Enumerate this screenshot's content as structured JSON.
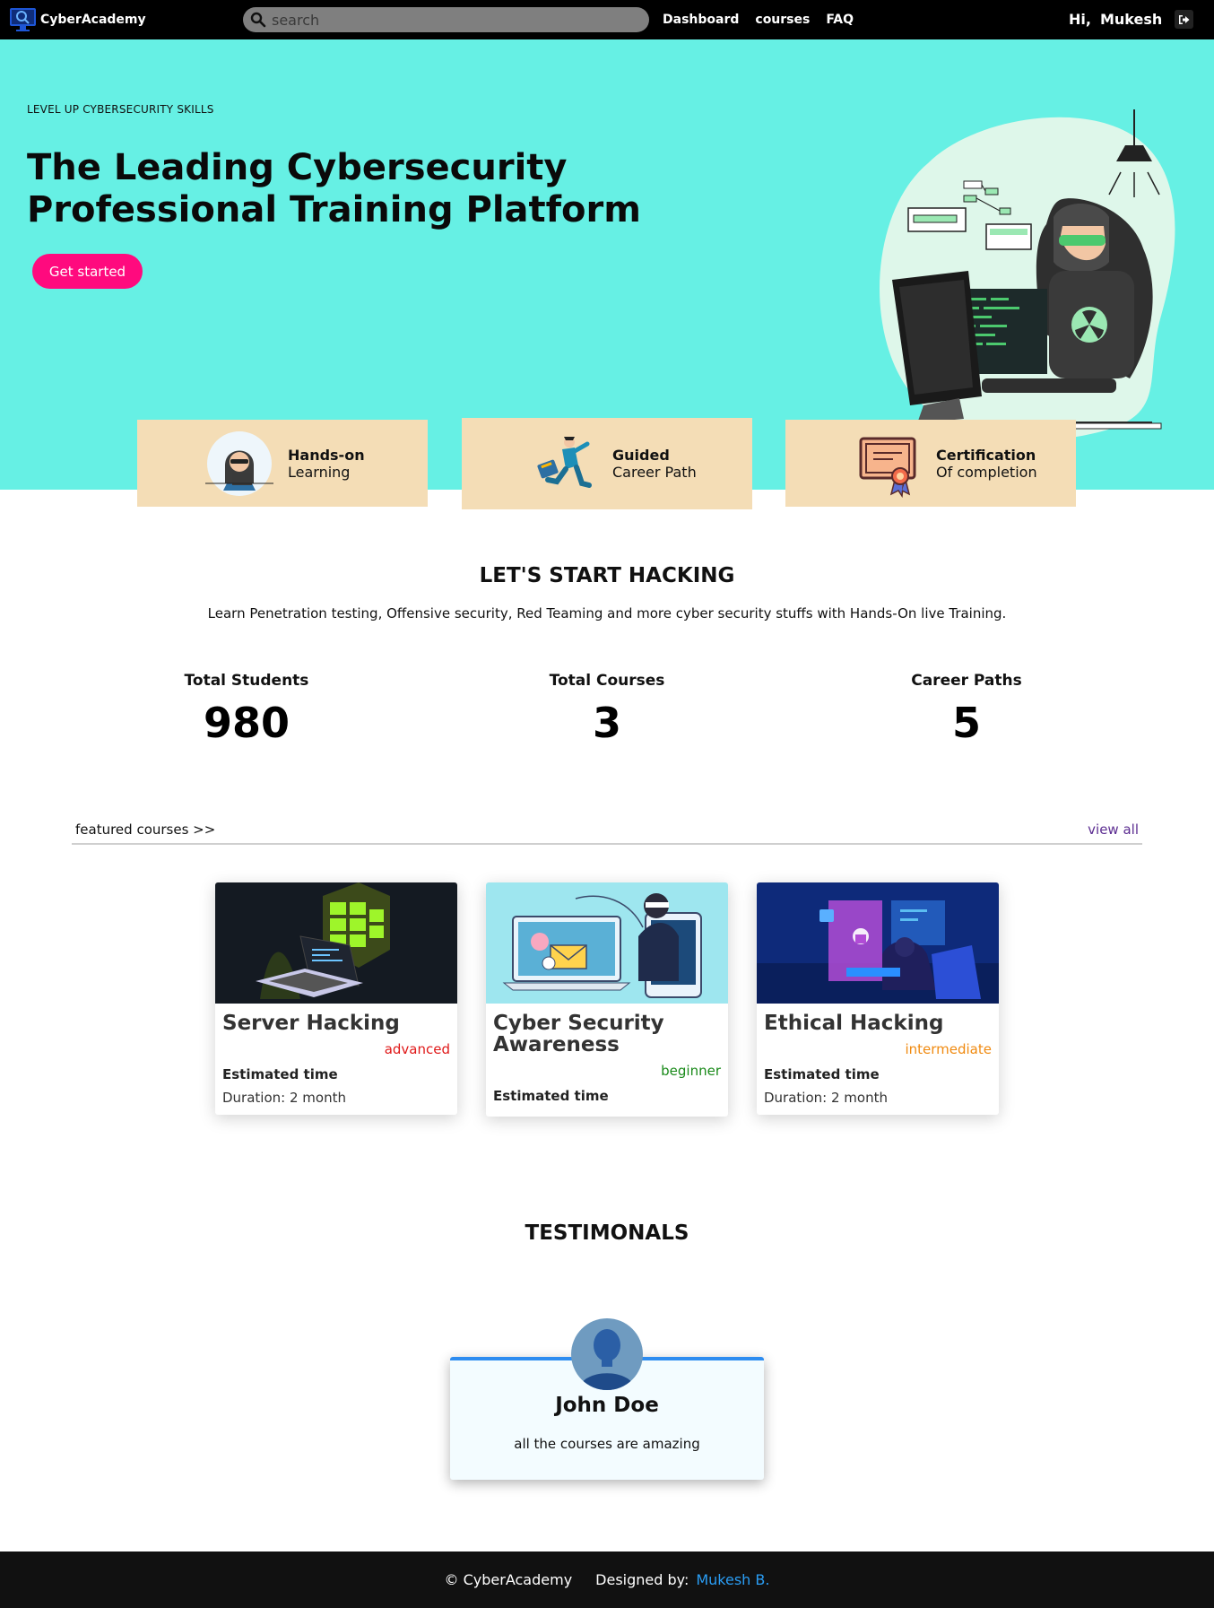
{
  "nav": {
    "brand": "CyberAcademy",
    "search_placeholder": "search",
    "links": [
      "Dashboard",
      "courses",
      "FAQ"
    ],
    "greeting": "Hi,",
    "user": "Mukesh",
    "logout_icon": "logout-icon"
  },
  "hero": {
    "kicker": "LEVEL UP CYBERSECURITY SKILLS",
    "title": "The Leading Cybersecurity Professional Training Platform",
    "cta": "Get started",
    "cta_color": "#ff0a7e",
    "background": "#66f0e4"
  },
  "features": [
    {
      "title": "Hands-on",
      "subtitle": "Learning",
      "icon": "hacker-avatar-icon"
    },
    {
      "title": "Guided",
      "subtitle": "Career Path",
      "icon": "running-man-icon"
    },
    {
      "title": "Certification",
      "subtitle": "Of completion",
      "icon": "certificate-icon"
    }
  ],
  "intro": {
    "title": "LET'S START HACKING",
    "subtitle": "Learn Penetration testing, Offensive security, Red Teaming and more cyber security stuffs with Hands-On live Training."
  },
  "stats": [
    {
      "label": "Total Students",
      "value": "980"
    },
    {
      "label": "Total Courses",
      "value": "3"
    },
    {
      "label": "Career Paths",
      "value": "5"
    }
  ],
  "featured": {
    "heading": "featured courses >>",
    "view_all": "view all",
    "courses": [
      {
        "title": "Server Hacking",
        "level": "advanced",
        "level_color": "#e01919",
        "est_label": "Estimated time",
        "duration": "Duration: 2 month"
      },
      {
        "title": "Cyber Security Awareness",
        "level": "beginner",
        "level_color": "#1a8a1a",
        "est_label": "Estimated time",
        "duration": ""
      },
      {
        "title": "Ethical Hacking",
        "level": "intermediate",
        "level_color": "#f08a10",
        "est_label": "Estimated time",
        "duration": "Duration: 2 month"
      }
    ]
  },
  "testimonials": {
    "title": "TESTIMONALS",
    "items": [
      {
        "name": "John Doe",
        "quote": "all the courses are amazing"
      }
    ]
  },
  "footer": {
    "copyright": "© CyberAcademy",
    "designed_label": "Designed by:",
    "author": "Mukesh B.",
    "author_color": "#2a9df4"
  }
}
